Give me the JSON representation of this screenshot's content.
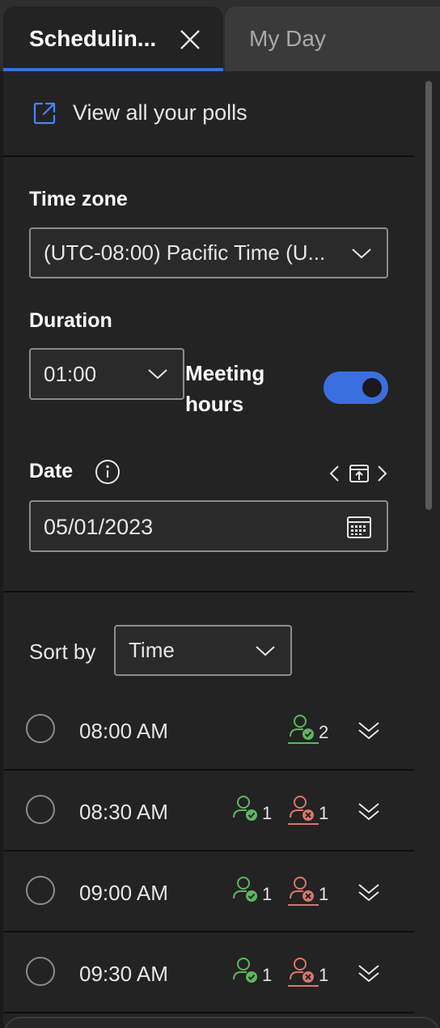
{
  "tabs": [
    {
      "label": "Schedulin...",
      "active": true
    },
    {
      "label": "My Day",
      "active": false
    }
  ],
  "polls_link": {
    "label": "View all your polls",
    "icon": "open-external-icon"
  },
  "time_zone": {
    "label": "Time zone",
    "value": "(UTC-08:00) Pacific Time (U..."
  },
  "duration": {
    "label": "Duration",
    "value": "01:00"
  },
  "meeting_hours": {
    "label_line1": "Meeting",
    "label_line2": "hours",
    "enabled": true
  },
  "date": {
    "label": "Date",
    "value": "05/01/2023"
  },
  "sort": {
    "label": "Sort by",
    "value": "Time"
  },
  "slots": [
    {
      "time": "08:00 AM",
      "accepted": "2",
      "declined": null
    },
    {
      "time": "08:30 AM",
      "accepted": "1",
      "declined": "1"
    },
    {
      "time": "09:00 AM",
      "accepted": "1",
      "declined": "1"
    },
    {
      "time": "09:30 AM",
      "accepted": "1",
      "declined": "1"
    }
  ],
  "colors": {
    "accent": "#3a6fe0",
    "accepted": "#5fb561",
    "declined": "#d9766f"
  }
}
